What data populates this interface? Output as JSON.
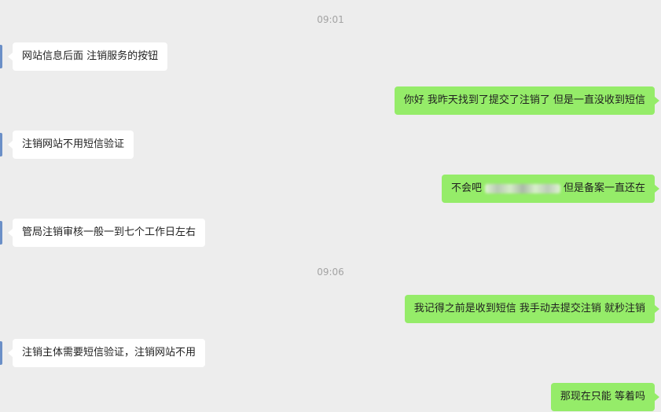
{
  "timestamps": [
    "09:01",
    "09:06"
  ],
  "messages": [
    {
      "side": "left",
      "text": "网站信息后面   注销服务的按钮"
    },
    {
      "side": "right",
      "text": "你好 我昨天找到了提交了注销了 但是一直没收到短信"
    },
    {
      "side": "left",
      "text": "注销网站不用短信验证"
    },
    {
      "side": "right",
      "text_before": "不会吧",
      "text_after": "但是备案一直还在"
    },
    {
      "side": "left",
      "text": "管局注销审核一般一到七个工作日左右"
    },
    {
      "side": "right",
      "text": "我记得之前是收到短信 我手动去提交注销 就秒注销"
    },
    {
      "side": "left",
      "text": "注销主体需要短信验证，注销网站不用"
    },
    {
      "side": "right",
      "text": "那现在只能 等着吗"
    }
  ],
  "colors": {
    "background": "#ededed",
    "incoming_bubble": "#ffffff",
    "outgoing_bubble": "#95ec69",
    "timestamp_text": "#a3a3a3"
  }
}
